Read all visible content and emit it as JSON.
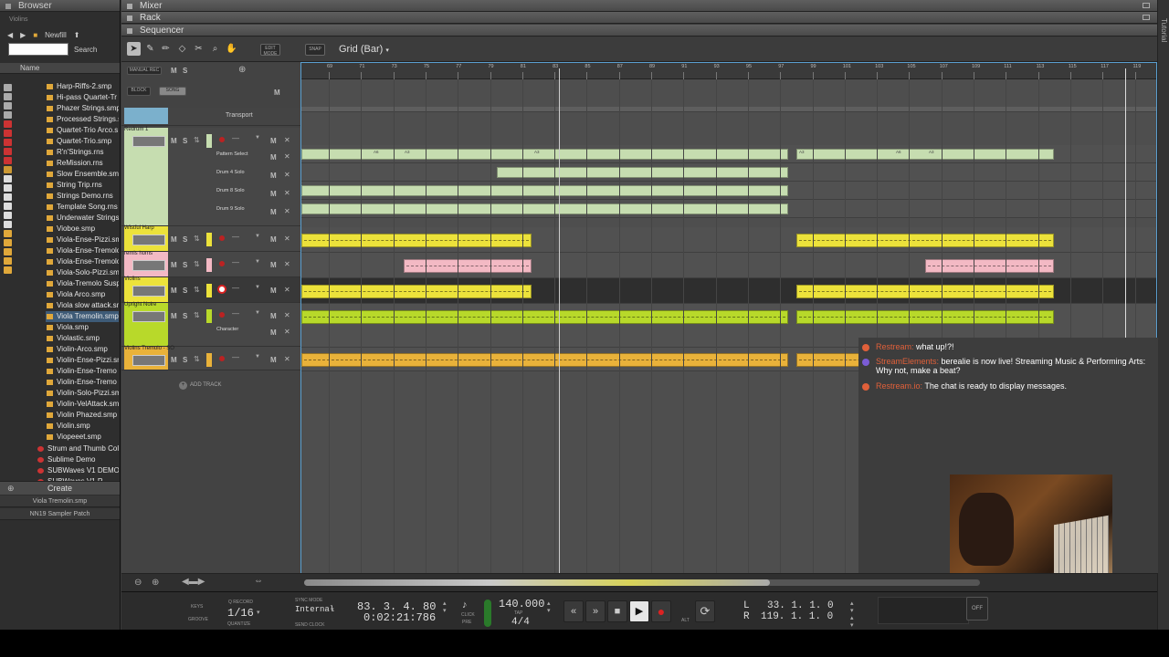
{
  "browser": {
    "title": "Browser",
    "breadcrumb": "Violins",
    "folder": "Newfill",
    "search_label": "Search",
    "column_name": "Name",
    "files": [
      "Harp-Riffs-2.smp",
      "Hi-pass Quartet-Tr",
      "Phazer Strings.smp",
      "Processed Strings.s",
      "Quartet-Trio Arco.s",
      "Quartet-Trio.smp",
      "R'n'Strings.rns",
      "ReMission.rns",
      "Slow Ensemble.smp",
      "String Trip.rns",
      "Strings Demo.rns",
      "Template Song.rns",
      "Underwater Strings.",
      "Vioboe.smp",
      "Viola-Ense-Pizzi.sm",
      "Viola-Ense-Tremolo",
      "Viola-Ense-Tremolo",
      "Viola-Solo-Pizzi.sm",
      "Viola-Tremolo Susp",
      "Viola Arco.smp",
      "Viola slow attack.sm",
      "Viola Tremolin.smp",
      "Viola.smp",
      "Violastic.smp",
      "Violin-Arco.smp",
      "Violin-Ense-Pizzi.sm",
      "Violin-Ense-Tremo",
      "Violin-Ense-Tremo",
      "Violin-Solo-Pizzi.sm",
      "Violin-VelAttack.sm",
      "Violin Phazed.smp",
      "Violin.smp",
      "Viopeeet.smp"
    ],
    "folders": [
      "Strum and Thumb Coll",
      "Sublime Demo",
      "SUBWaves V1 DEMO R",
      "SUBWaves V1 R..."
    ],
    "create_label": "Create",
    "selected_file": "Viola Tremolin.smp",
    "patch": "NN19 Sampler Patch"
  },
  "panels": {
    "mixer": "Mixer",
    "rack": "Rack",
    "sequencer": "Sequencer",
    "tutorial": "Tutorial"
  },
  "seq_toolbar": {
    "edit_mode": "EDIT MODE",
    "snap": "SNAP",
    "grid": "Grid (Bar)"
  },
  "track_header": {
    "manual_rec": "MANUAL REC",
    "block": "BLOCK",
    "song": "SONG",
    "m": "M",
    "s": "S",
    "transport_track": "Transport",
    "tracks": [
      {
        "name": "Redrum 1",
        "color": "#c6ddb0",
        "lanes": [
          "Pattern Select",
          "Drum 4 Solo",
          "Drum 8 Solo",
          "Drum 9 Solo"
        ]
      },
      {
        "name": "Wistful Harp",
        "color": "#ece23b"
      },
      {
        "name": "remis homs",
        "color": "#f3b9c4"
      },
      {
        "name": "Violins",
        "color": "#ece23b"
      },
      {
        "name": "Upright Noire",
        "color": "#b8d92a",
        "lanes": [
          "Character"
        ]
      },
      {
        "name": "Violins Tremolo - SO",
        "color": "#e9b23a"
      }
    ],
    "add_track": "ADD TRACK"
  },
  "ruler_ticks": [
    "69",
    "71",
    "73",
    "75",
    "77",
    "79",
    "81",
    "83",
    "85",
    "87",
    "89",
    "91",
    "93",
    "95",
    "97",
    "99",
    "101",
    "103",
    "105",
    "107",
    "109",
    "111",
    "113",
    "115",
    "117",
    "119"
  ],
  "clip_labels": [
    "A6",
    "A3",
    "A3",
    "A3",
    "A6",
    "A3"
  ],
  "chat": [
    {
      "user": "Restream:",
      "text": "what up!?!",
      "icon_color": "#e0603a"
    },
    {
      "user": "StreamElements:",
      "text": "berealie is now live! Streaming Music & Performing Arts: Why not, make a beat?",
      "icon_color": "#7b5cd6"
    },
    {
      "user": "Restream.io:",
      "text": "The chat is ready to display messages.",
      "icon_color": "#e0603a"
    }
  ],
  "transport": {
    "keys": "KEYS",
    "groove": "GROOVE",
    "q_record": "Q RECORD",
    "quantize_value": "1/16",
    "quantize": "QUANTIZE",
    "sync_mode": "SYNC MODE",
    "sync_value": "Internal",
    "send_clock": "SEND CLOCK",
    "position": "83. 3. 4. 80",
    "time": "0:02:21:786",
    "click": "CLICK",
    "pre": "PRE",
    "tempo": "140.000",
    "tap": "TAP",
    "signature": "4/4",
    "alt": "ALT",
    "left_label": "L",
    "left_pos": "33. 1. 1. 0",
    "right_label": "R",
    "right_pos": "119. 1. 1. 0",
    "off": "OFF"
  },
  "colors": {
    "accent_blue": "#5a9fd0",
    "record": "#d22"
  }
}
